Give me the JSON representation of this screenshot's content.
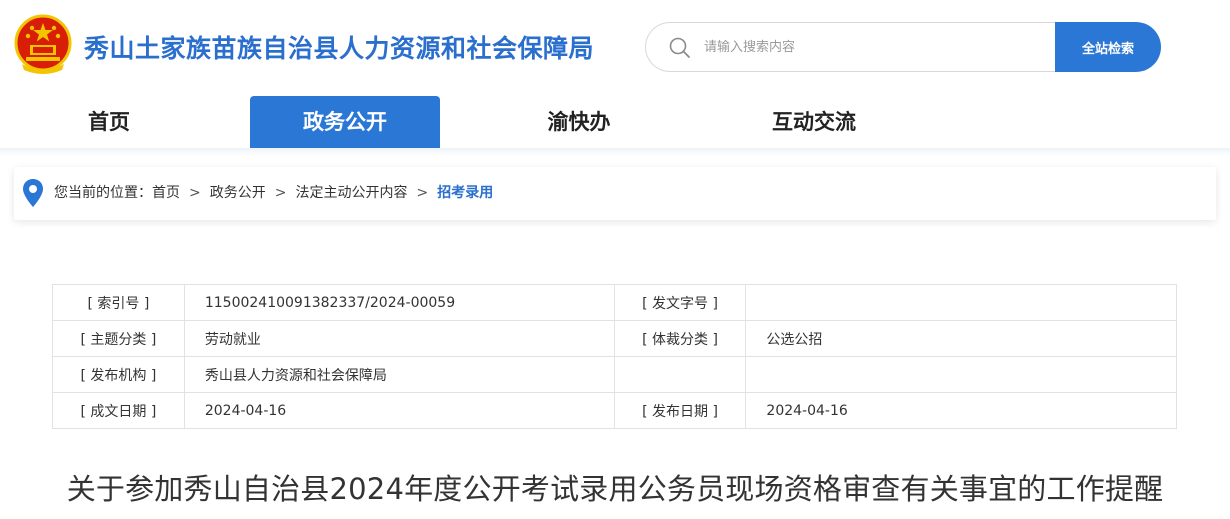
{
  "header": {
    "site_title": "秀山土家族苗族自治县人力资源和社会保障局",
    "emblem_icon": "national-emblem-icon",
    "search": {
      "placeholder": "请输入搜索内容",
      "button_label": "全站检索"
    }
  },
  "nav": {
    "items": [
      {
        "label": "首页",
        "active": false
      },
      {
        "label": "政务公开",
        "active": true
      },
      {
        "label": "渝快办",
        "active": false
      },
      {
        "label": "互动交流",
        "active": false
      }
    ]
  },
  "breadcrumb": {
    "prefix": "您当前的位置：",
    "items": [
      "首页",
      "政务公开",
      "法定主动公开内容",
      "招考录用"
    ],
    "separator": ">"
  },
  "info": {
    "rows": [
      {
        "label1": "[ 索引号 ]",
        "value1": "11500241009138233 7/2024-00059",
        "label2": "[ 发文字号 ]",
        "value2": ""
      },
      {
        "label1": "[ 主题分类 ]",
        "value1": "劳动就业",
        "label2": "[ 体裁分类 ]",
        "value2": "公选公招"
      },
      {
        "label1": "[ 发布机构 ]",
        "value1": "秀山县人力资源和社会保障局",
        "label2": "",
        "value2": ""
      },
      {
        "label1": "[ 成文日期 ]",
        "value1": "2024-04-16",
        "label2": "[ 发布日期 ]",
        "value2": "2024-04-16"
      }
    ]
  },
  "article": {
    "title": "关于参加秀山自治县2024年度公开考试录用公务员现场资格审查有关事宜的工作提醒"
  },
  "colors": {
    "accent": "#2b77d6",
    "title_blue": "#2b6fce"
  }
}
